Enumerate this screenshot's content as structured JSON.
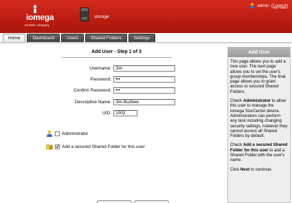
{
  "header": {
    "brand": "iomega",
    "brand_sub": "an EMC company",
    "device_name": "storage",
    "user": "admin",
    "logout": "(Logout)",
    "brand_color": "#c8281b"
  },
  "tabs": [
    {
      "label": "Home",
      "active": true
    },
    {
      "label": "Dashboard",
      "active": false
    },
    {
      "label": "Users",
      "active": false
    },
    {
      "label": "Shared Folders",
      "active": false
    },
    {
      "label": "Settings",
      "active": false
    }
  ],
  "form": {
    "title": "Add User - Step 1 of 3",
    "username_label": "Username:",
    "username_value": "Jim",
    "password_label": "Password:",
    "password_value": "•••",
    "confirm_label": "Confirm Password:",
    "confirm_value": "•••",
    "descname_label": "Descriptive Name:",
    "descname_value": "Jim Buzbee",
    "uid_label": "UID:",
    "uid_value": "1002",
    "administrator_label": "Administrator",
    "administrator_checked": false,
    "secured_folder_label": "Add a secured Shared Folder for this user",
    "secured_folder_checked": true
  },
  "sidebar": {
    "title": "Add User",
    "p1": "This page allows you to add a new user. The next page allows you to set the user's group memberships. The final page allows you to grant access to secured Shared Folders.",
    "p2_pre": "Check ",
    "p2_bold": "Administrator",
    "p2_post": " to allow this user to manage the Iomega StorCenter device. Administrators can perform any task including changing security settings, however they cannot access all Shared Folders by default.",
    "p3_pre": "Check ",
    "p3_bold": "Add a secured Shared Folder for this user",
    "p3_post": " to add a Shared Folder with the user's name.",
    "p4_pre": "Click ",
    "p4_bold": "Next",
    "p4_post": " to continue."
  }
}
